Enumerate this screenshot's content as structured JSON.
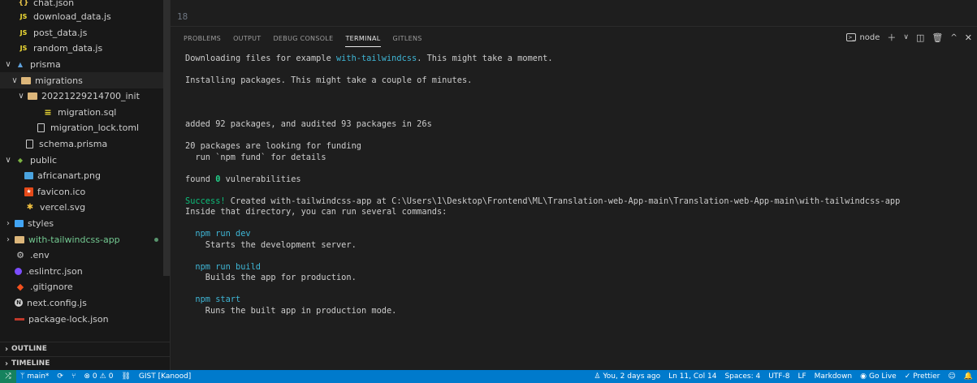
{
  "explorer": {
    "items": [
      {
        "label": "chat.json",
        "icon": "json-icon"
      },
      {
        "label": "download_data.js",
        "icon": "js-icon"
      },
      {
        "label": "post_data.js",
        "icon": "js-icon"
      },
      {
        "label": "random_data.js",
        "icon": "js-icon"
      },
      {
        "label": "prisma",
        "icon": "prisma-folder-icon"
      },
      {
        "label": "migrations",
        "icon": "folder-icon"
      },
      {
        "label": "20221229214700_init",
        "icon": "folder-icon"
      },
      {
        "label": "migration.sql",
        "icon": "database-icon"
      },
      {
        "label": "migration_lock.toml",
        "icon": "file-icon"
      },
      {
        "label": "schema.prisma",
        "icon": "file-icon"
      },
      {
        "label": "public",
        "icon": "public-folder-icon"
      },
      {
        "label": "africanart.png",
        "icon": "image-icon"
      },
      {
        "label": "favicon.ico",
        "icon": "favicon-icon"
      },
      {
        "label": "vercel.svg",
        "icon": "svg-icon"
      },
      {
        "label": "styles",
        "icon": "styles-folder-icon"
      },
      {
        "label": "with-tailwindcss-app",
        "icon": "folder-icon"
      },
      {
        "label": ".env",
        "icon": "gear-icon"
      },
      {
        "label": ".eslintrc.json",
        "icon": "eslint-icon"
      },
      {
        "label": ".gitignore",
        "icon": "git-icon"
      },
      {
        "label": "next.config.js",
        "icon": "next-icon"
      },
      {
        "label": "package-lock.json",
        "icon": "lock-icon"
      }
    ],
    "outline_label": "OUTLINE",
    "timeline_label": "TIMELINE"
  },
  "editor": {
    "line_number": "18"
  },
  "panel": {
    "tabs": [
      {
        "label": "PROBLEMS"
      },
      {
        "label": "OUTPUT"
      },
      {
        "label": "DEBUG CONSOLE"
      },
      {
        "label": "TERMINAL"
      },
      {
        "label": "GITLENS"
      }
    ],
    "active_tab": "TERMINAL",
    "terminal_name": "node"
  },
  "terminal": {
    "line1_pre": "Downloading files for example ",
    "line1_link": "with-tailwindcss",
    "line1_post": ". This might take a moment.",
    "line2": "Installing packages. This might take a couple of minutes.",
    "line3": "added 92 packages, and audited 93 packages in 26s",
    "line4": "20 packages are looking for funding",
    "line5": "  run `npm fund` for details",
    "line6_pre": "found ",
    "line6_num": "0",
    "line6_post": " vulnerabilities",
    "line7_success": "Success!",
    "line7_rest": " Created with-tailwindcss-app at C:\\Users\\1\\Desktop\\Frontend\\ML\\Translation-web-App-main\\Translation-web-App-main\\with-tailwindcss-app",
    "line8": "Inside that directory, you can run several commands:",
    "cmd1": "  npm run dev",
    "cmd1_desc": "    Starts the development server.",
    "cmd2": "  npm run build",
    "cmd2_desc": "    Builds the app for production.",
    "cmd3": "  npm start",
    "cmd3_desc": "    Runs the built app in production mode."
  },
  "statusbar": {
    "branch": "main*",
    "errors": "0",
    "warnings": "0",
    "gist": "GIST [Kanood]",
    "blame": "You, 2 days ago",
    "position": "Ln 11, Col 14",
    "spaces": "Spaces: 4",
    "encoding": "UTF-8",
    "eol": "LF",
    "language": "Markdown",
    "golive": "Go Live",
    "prettier": "Prettier"
  }
}
